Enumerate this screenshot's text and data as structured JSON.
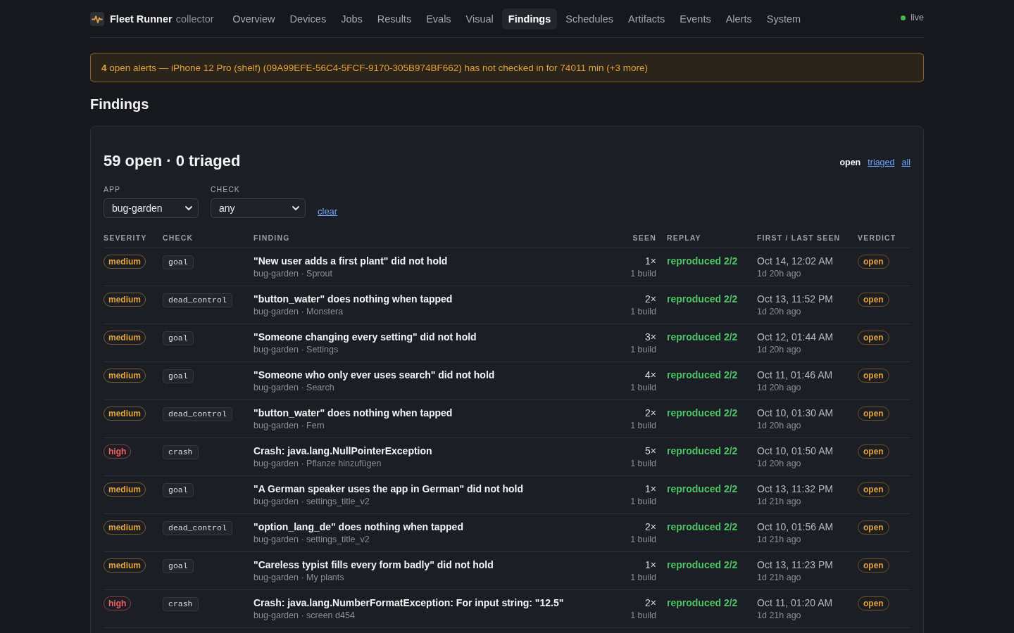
{
  "nav": {
    "brand": "Fleet Runner",
    "brand_sub": "collector",
    "items": [
      {
        "label": "Overview",
        "selected": false
      },
      {
        "label": "Devices",
        "selected": false
      },
      {
        "label": "Jobs",
        "selected": false
      },
      {
        "label": "Results",
        "selected": false
      },
      {
        "label": "Evals",
        "selected": false
      },
      {
        "label": "Visual",
        "selected": false
      },
      {
        "label": "Findings",
        "selected": true
      },
      {
        "label": "Schedules",
        "selected": false
      },
      {
        "label": "Artifacts",
        "selected": false
      },
      {
        "label": "Events",
        "selected": false
      },
      {
        "label": "Alerts",
        "selected": false
      },
      {
        "label": "System",
        "selected": false
      }
    ],
    "status": "live"
  },
  "alert_banner": "**4** open alerts — iPhone 12 Pro (shelf) (09A99EFE-56C4-5FCF-9170-305B974BF662) has not checked in for 74011 min (+3 more)",
  "page_title": "Findings",
  "panel": {
    "title": "59 open · 0 triaged",
    "view_filters": [
      {
        "label": "open",
        "selected": true
      },
      {
        "label": "triaged",
        "selected": false
      },
      {
        "label": "all",
        "selected": false
      }
    ],
    "filters": [
      {
        "label": "APP",
        "value": "bug-garden"
      },
      {
        "label": "CHECK",
        "value": "any"
      }
    ],
    "clear_link": "clear",
    "table": {
      "columns": [
        "SEVERITY",
        "CHECK",
        "FINDING",
        "SEEN",
        "REPLAY",
        "FIRST / LAST SEEN",
        "VERDICT"
      ],
      "rows": [
        {
          "severity": {
            "label": "medium",
            "color": "#e3a33a"
          },
          "check": "goal",
          "title": "\"New user adds a first plant\" did not hold",
          "subtitle": "bug-garden · Sprout",
          "seen": "1×",
          "builds": "1 build",
          "replay": "reproduced 2/2",
          "first_seen": "Oct 14, 12:02 AM",
          "last_seen": "1d 20h ago",
          "verdict": "open"
        },
        {
          "severity": {
            "label": "medium",
            "color": "#e3a33a"
          },
          "check": "dead_control",
          "title": "\"button_water\" does nothing when tapped",
          "subtitle": "bug-garden · Monstera",
          "seen": "2×",
          "builds": "1 build",
          "replay": "reproduced 2/2",
          "first_seen": "Oct 13, 11:52 PM",
          "last_seen": "1d 20h ago",
          "verdict": "open"
        },
        {
          "severity": {
            "label": "medium",
            "color": "#e3a33a"
          },
          "check": "goal",
          "title": "\"Someone changing every setting\" did not hold",
          "subtitle": "bug-garden · Settings",
          "seen": "3×",
          "builds": "1 build",
          "replay": "reproduced 2/2",
          "first_seen": "Oct 12, 01:44 AM",
          "last_seen": "1d 20h ago",
          "verdict": "open"
        },
        {
          "severity": {
            "label": "medium",
            "color": "#e3a33a"
          },
          "check": "goal",
          "title": "\"Someone who only ever uses search\" did not hold",
          "subtitle": "bug-garden · Search",
          "seen": "4×",
          "builds": "1 build",
          "replay": "reproduced 2/2",
          "first_seen": "Oct 11, 01:46 AM",
          "last_seen": "1d 20h ago",
          "verdict": "open"
        },
        {
          "severity": {
            "label": "medium",
            "color": "#e3a33a"
          },
          "check": "dead_control",
          "title": "\"button_water\" does nothing when tapped",
          "subtitle": "bug-garden · Fern",
          "seen": "2×",
          "builds": "1 build",
          "replay": "reproduced 2/2",
          "first_seen": "Oct 10, 01:30 AM",
          "last_seen": "1d 20h ago",
          "verdict": "open"
        },
        {
          "severity": {
            "label": "high",
            "color": "#f0625f"
          },
          "check": "crash",
          "title": "Crash: java.lang.NullPointerException",
          "subtitle": "bug-garden · Pflanze hinzufügen",
          "seen": "5×",
          "builds": "1 build",
          "replay": "reproduced 2/2",
          "first_seen": "Oct 10, 01:50 AM",
          "last_seen": "1d 20h ago",
          "verdict": "open"
        },
        {
          "severity": {
            "label": "medium",
            "color": "#e3a33a"
          },
          "check": "goal",
          "title": "\"A German speaker uses the app in German\" did not hold",
          "subtitle": "bug-garden · settings_title_v2",
          "seen": "1×",
          "builds": "1 build",
          "replay": "reproduced 2/2",
          "first_seen": "Oct 13, 11:32 PM",
          "last_seen": "1d 21h ago",
          "verdict": "open"
        },
        {
          "severity": {
            "label": "medium",
            "color": "#e3a33a"
          },
          "check": "dead_control",
          "title": "\"option_lang_de\" does nothing when tapped",
          "subtitle": "bug-garden · settings_title_v2",
          "seen": "2×",
          "builds": "1 build",
          "replay": "reproduced 2/2",
          "first_seen": "Oct 10, 01:56 AM",
          "last_seen": "1d 21h ago",
          "verdict": "open"
        },
        {
          "severity": {
            "label": "medium",
            "color": "#e3a33a"
          },
          "check": "goal",
          "title": "\"Careless typist fills every form badly\" did not hold",
          "subtitle": "bug-garden · My plants",
          "seen": "1×",
          "builds": "1 build",
          "replay": "reproduced 2/2",
          "first_seen": "Oct 13, 11:23 PM",
          "last_seen": "1d 21h ago",
          "verdict": "open"
        },
        {
          "severity": {
            "label": "high",
            "color": "#f0625f"
          },
          "check": "crash",
          "title": "Crash: java.lang.NumberFormatException: For input string: \"12.5\"",
          "subtitle": "bug-garden · screen d454",
          "seen": "2×",
          "builds": "1 build",
          "replay": "reproduced 2/2",
          "first_seen": "Oct 11, 01:20 AM",
          "last_seen": "1d 21h ago",
          "verdict": "open"
        }
      ]
    }
  }
}
